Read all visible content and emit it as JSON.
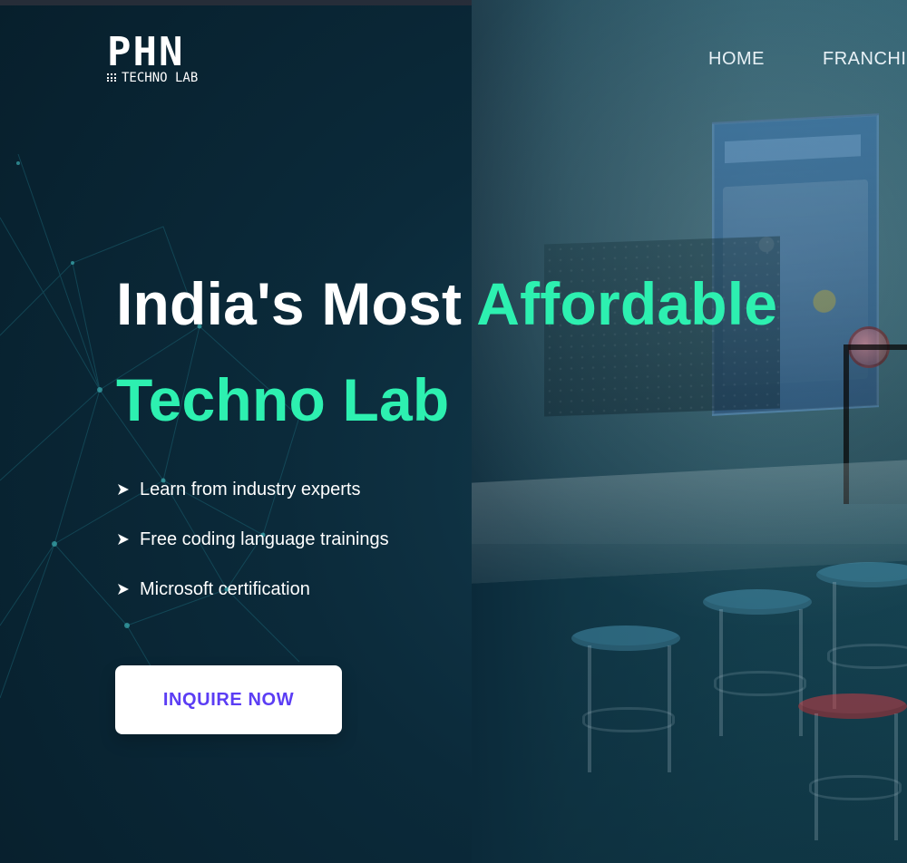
{
  "brand": {
    "logo_main": "PHN",
    "logo_sub": "TECHNO LAB"
  },
  "nav": {
    "items": [
      {
        "label": "HOME"
      },
      {
        "label": "FRANCHI"
      }
    ]
  },
  "hero": {
    "title_line1_plain": "India's Most ",
    "title_line1_accent": "Affordable",
    "title_line2_accent": "Techno Lab",
    "bullets": [
      {
        "text": "Learn from industry experts"
      },
      {
        "text": "Free coding language trainings"
      },
      {
        "text": "Microsoft certification"
      }
    ],
    "cta_label": "INQUIRE NOW"
  },
  "colors": {
    "accent": "#2df0b0",
    "cta_text": "#5b3df4",
    "background": "#0b2a3a"
  },
  "icons": {
    "bullet_icon": "arrow-right-icon",
    "logo_grid_icon": "dot-grid-icon"
  }
}
